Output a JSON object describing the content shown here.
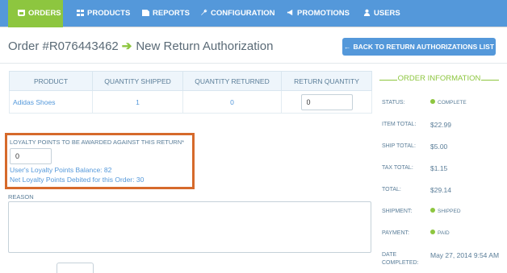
{
  "nav": {
    "items": [
      {
        "label": "ORDERS",
        "icon": "cart-icon",
        "active": true
      },
      {
        "label": "PRODUCTS",
        "icon": "grid-icon",
        "active": false
      },
      {
        "label": "REPORTS",
        "icon": "document-icon",
        "active": false
      },
      {
        "label": "CONFIGURATION",
        "icon": "wrench-icon",
        "active": false
      },
      {
        "label": "PROMOTIONS",
        "icon": "megaphone-icon",
        "active": false
      },
      {
        "label": "USERS",
        "icon": "user-icon",
        "active": false
      }
    ]
  },
  "header": {
    "order_number": "Order #R076443462",
    "arrow": "➔",
    "title": "New Return Authorization",
    "back_button_label": "BACK TO RETURN AUTHORIZATIONS LIST",
    "back_icon": "arrow-left-icon"
  },
  "items_table": {
    "columns": [
      "PRODUCT",
      "QUANTITY SHIPPED",
      "QUANTITY RETURNED",
      "RETURN QUANTITY"
    ],
    "rows": [
      {
        "product": "Adidas Shoes",
        "quantity_shipped": "1",
        "quantity_returned": "0",
        "return_quantity": "0"
      }
    ]
  },
  "loyalty": {
    "label": "LOYALTY POINTS TO BE AWARDED AGAINST THIS RETURN*",
    "value": "0",
    "balance_text": "User's Loyalty Points Balance: 82",
    "debited_text": "Net Loyalty Points Debited for this Order: 30"
  },
  "reason": {
    "label": "REASON",
    "value": ""
  },
  "order_info": {
    "title": "ORDER INFORMATION",
    "status_label": "STATUS:",
    "status_value": "COMPLETE",
    "item_total_label": "ITEM TOTAL:",
    "item_total_value": "$22.99",
    "ship_total_label": "SHIP TOTAL:",
    "ship_total_value": "$5.00",
    "tax_total_label": "TAX TOTAL:",
    "tax_total_value": "$1.15",
    "total_label": "TOTAL:",
    "total_value": "$29.14",
    "shipment_label": "SHIPMENT:",
    "shipment_value": "SHIPPED",
    "payment_label": "PAYMENT:",
    "payment_value": "PAID",
    "date_completed_label": "DATE COMPLETED:",
    "date_completed_value": "May 27, 2014 9:54 AM",
    "status_color": "#8dc63f"
  },
  "colors": {
    "nav_bg": "#5498da",
    "nav_active": "#8dc63f",
    "highlight_border": "#d66a2b",
    "link_blue": "#5498da"
  }
}
